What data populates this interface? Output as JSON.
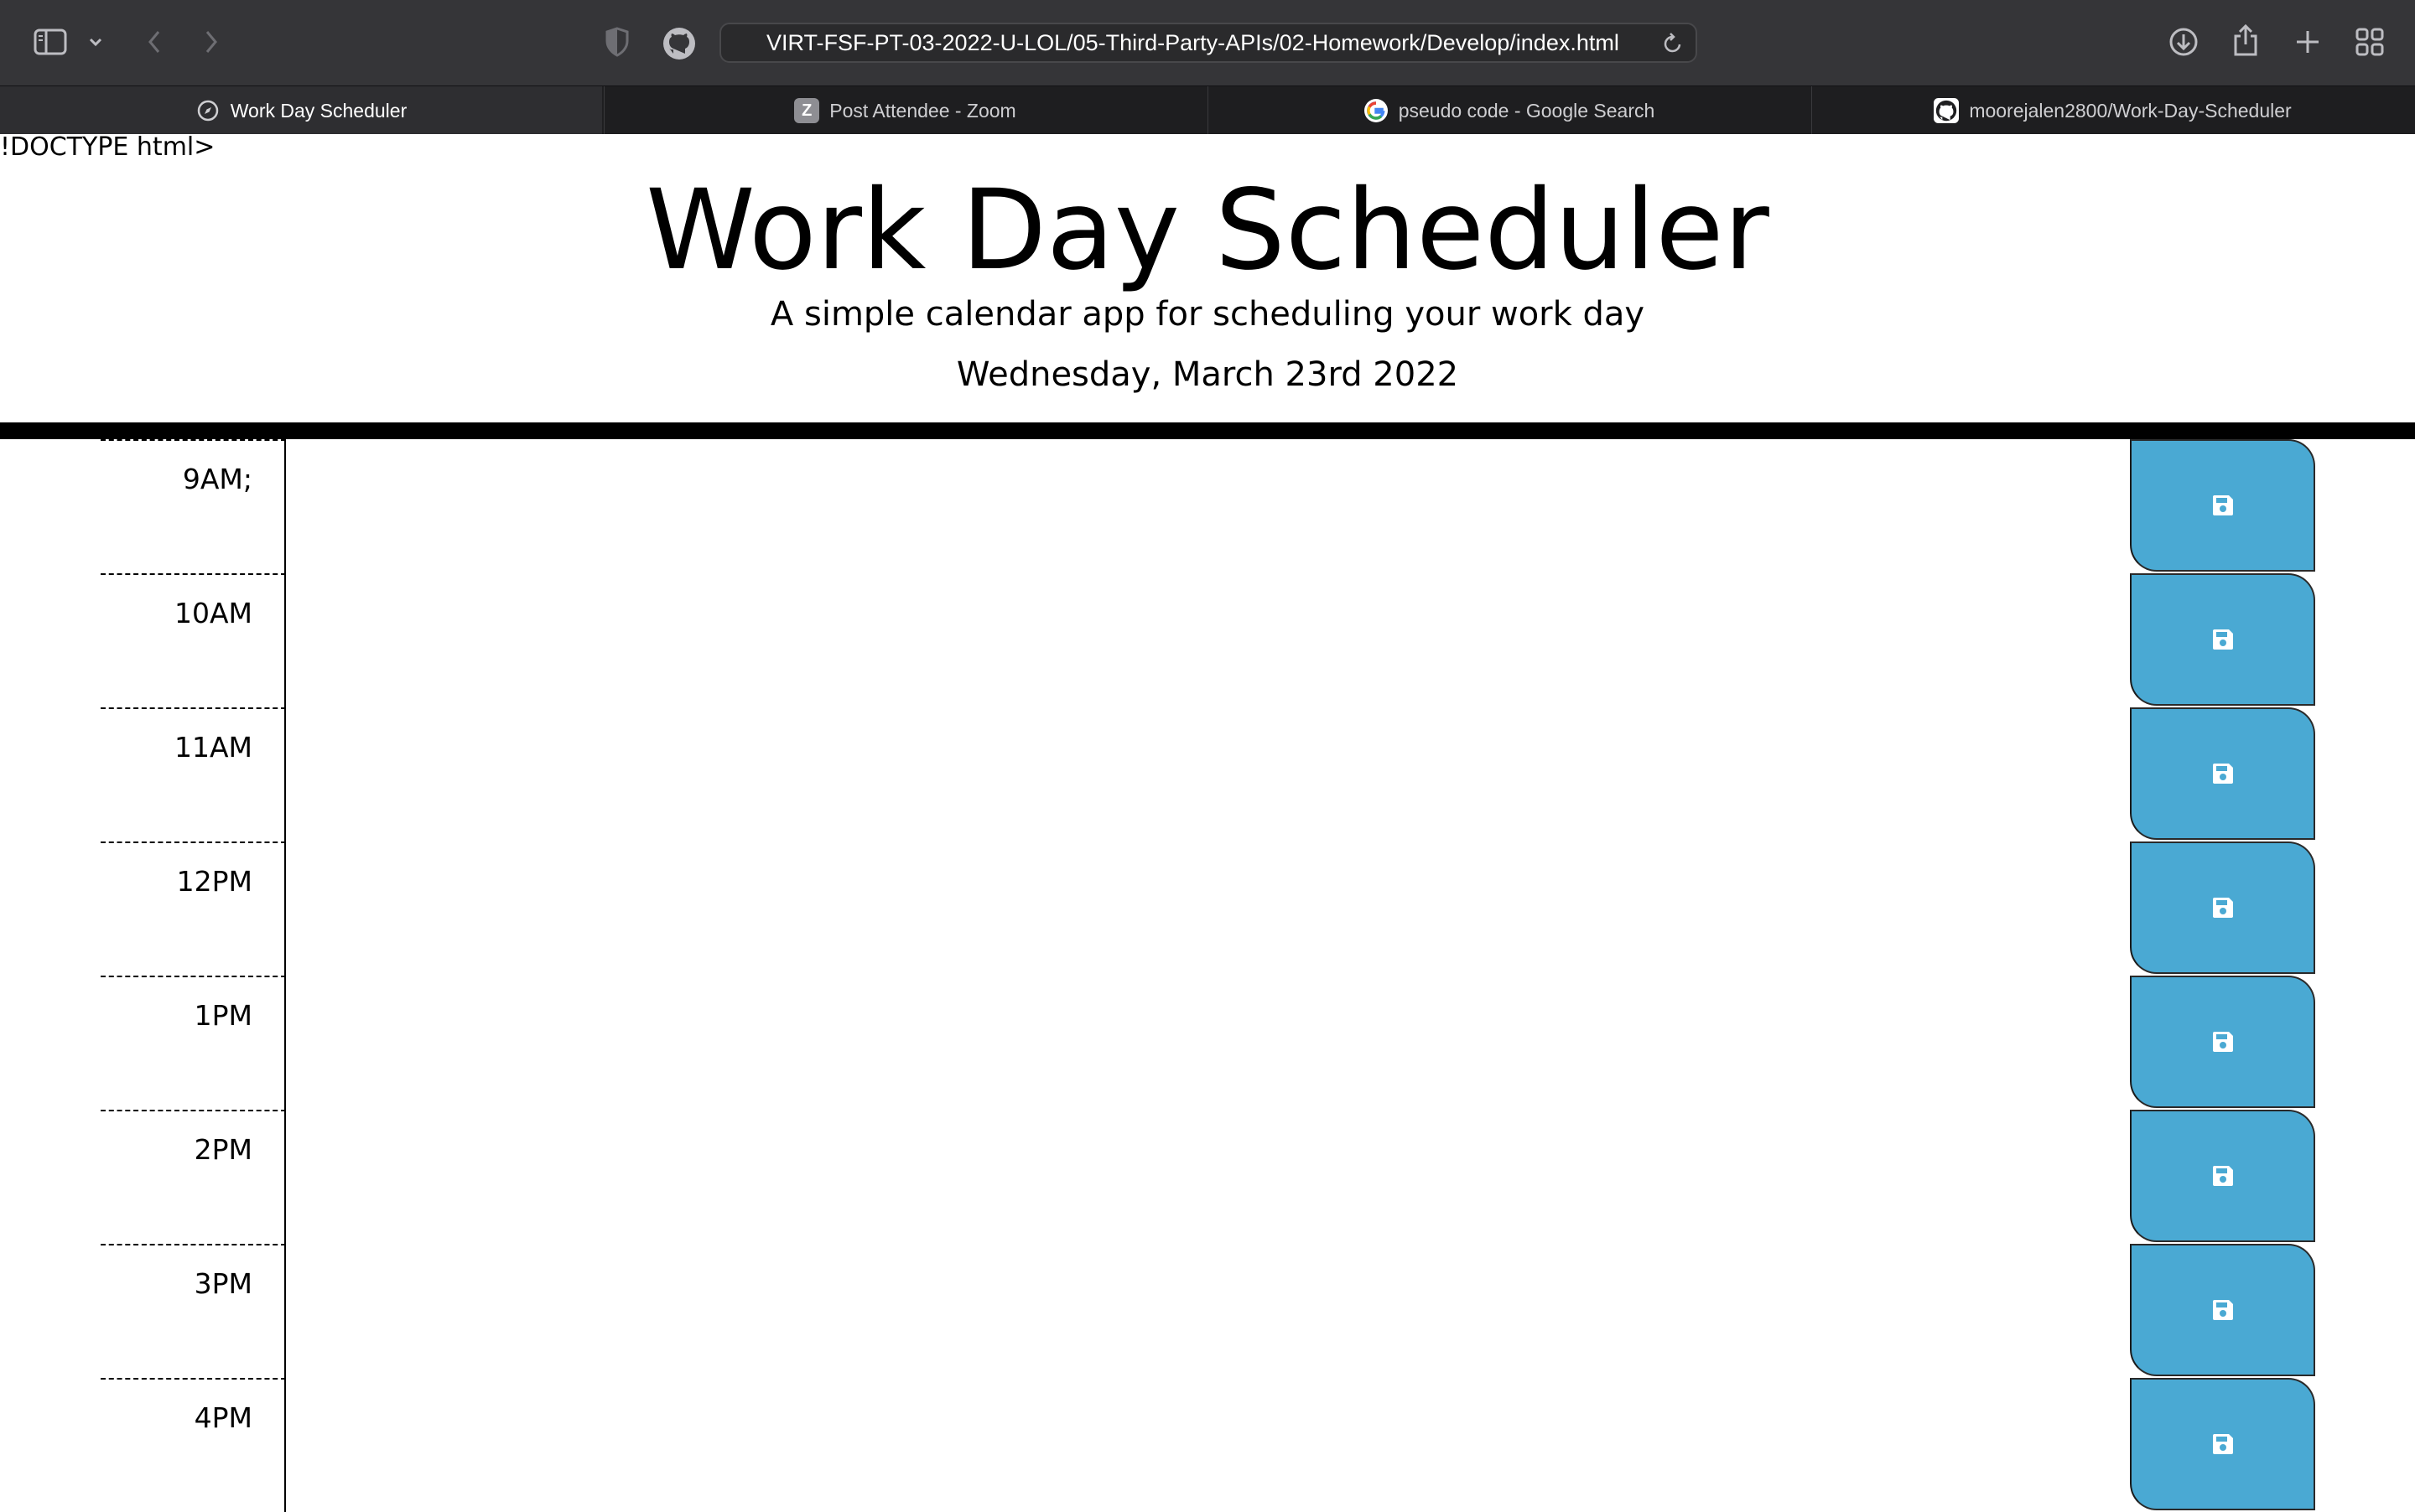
{
  "browser": {
    "url": "VIRT-FSF-PT-03-2022-U-LOL/05-Third-Party-APIs/02-Homework/Develop/index.html",
    "tabs": [
      {
        "label": "Work Day Scheduler",
        "icon": "compass-icon",
        "active": true
      },
      {
        "label": "Post Attendee - Zoom",
        "icon": "zoom-icon",
        "active": false
      },
      {
        "label": "pseudo code - Google Search",
        "icon": "google-icon",
        "active": false
      },
      {
        "label": "moorejalen2800/Work-Day-Scheduler",
        "icon": "github-icon",
        "active": false
      }
    ],
    "zoom_icon_letter": "Z",
    "google_icon_letter": "G"
  },
  "page": {
    "doctype_text": "!DOCTYPE html>",
    "title": "Work Day Scheduler",
    "lead": "A simple calendar app for scheduling your work day",
    "current_date": "Wednesday, March 23rd 2022"
  },
  "schedule": {
    "hours": [
      {
        "label": "9AM;"
      },
      {
        "label": "10AM"
      },
      {
        "label": "11AM"
      },
      {
        "label": "12PM"
      },
      {
        "label": "1PM"
      },
      {
        "label": "2PM"
      },
      {
        "label": "3PM"
      },
      {
        "label": "4PM"
      }
    ],
    "save_icon": "floppy-disk-icon"
  },
  "colors": {
    "save_button": "#4aa9d3",
    "toolbar": "#353538",
    "tabbar": "#1e1e20"
  }
}
